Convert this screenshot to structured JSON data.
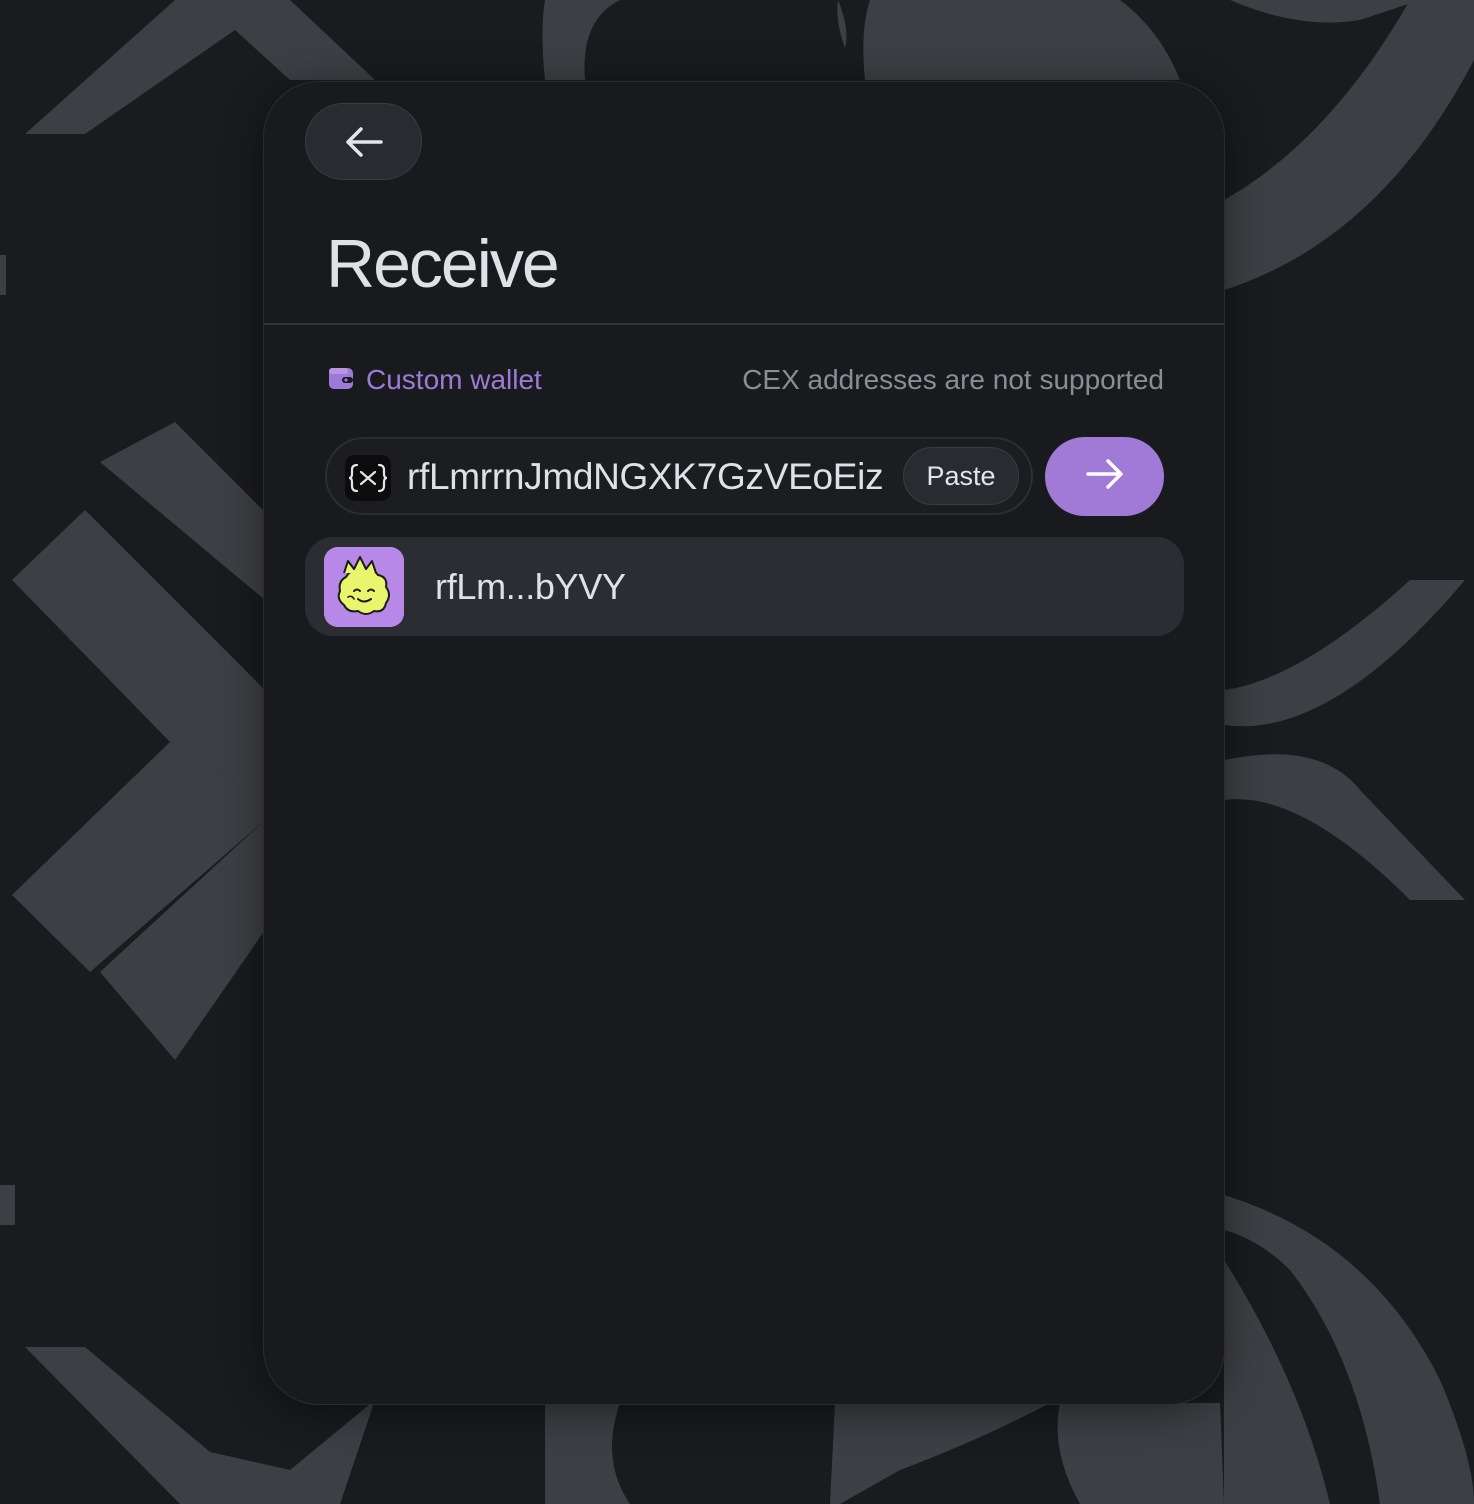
{
  "page": {
    "title": "Receive",
    "background_color": "#1a1b1f",
    "accent_color": "#a07ad6"
  },
  "header": {
    "back_icon": "arrow-left-icon"
  },
  "wallet": {
    "icon": "wallet-icon",
    "label": "Custom wallet",
    "note": "CEX addresses are not supported"
  },
  "address": {
    "icon": "variable-icon",
    "value": "rfLmrrnJmdNGXK7GzVEoEiz",
    "paste_label": "Paste",
    "submit_icon": "arrow-right-icon"
  },
  "suggestion": {
    "avatar": "brain-mascot-avatar",
    "label": "rfLm...bYVY"
  }
}
